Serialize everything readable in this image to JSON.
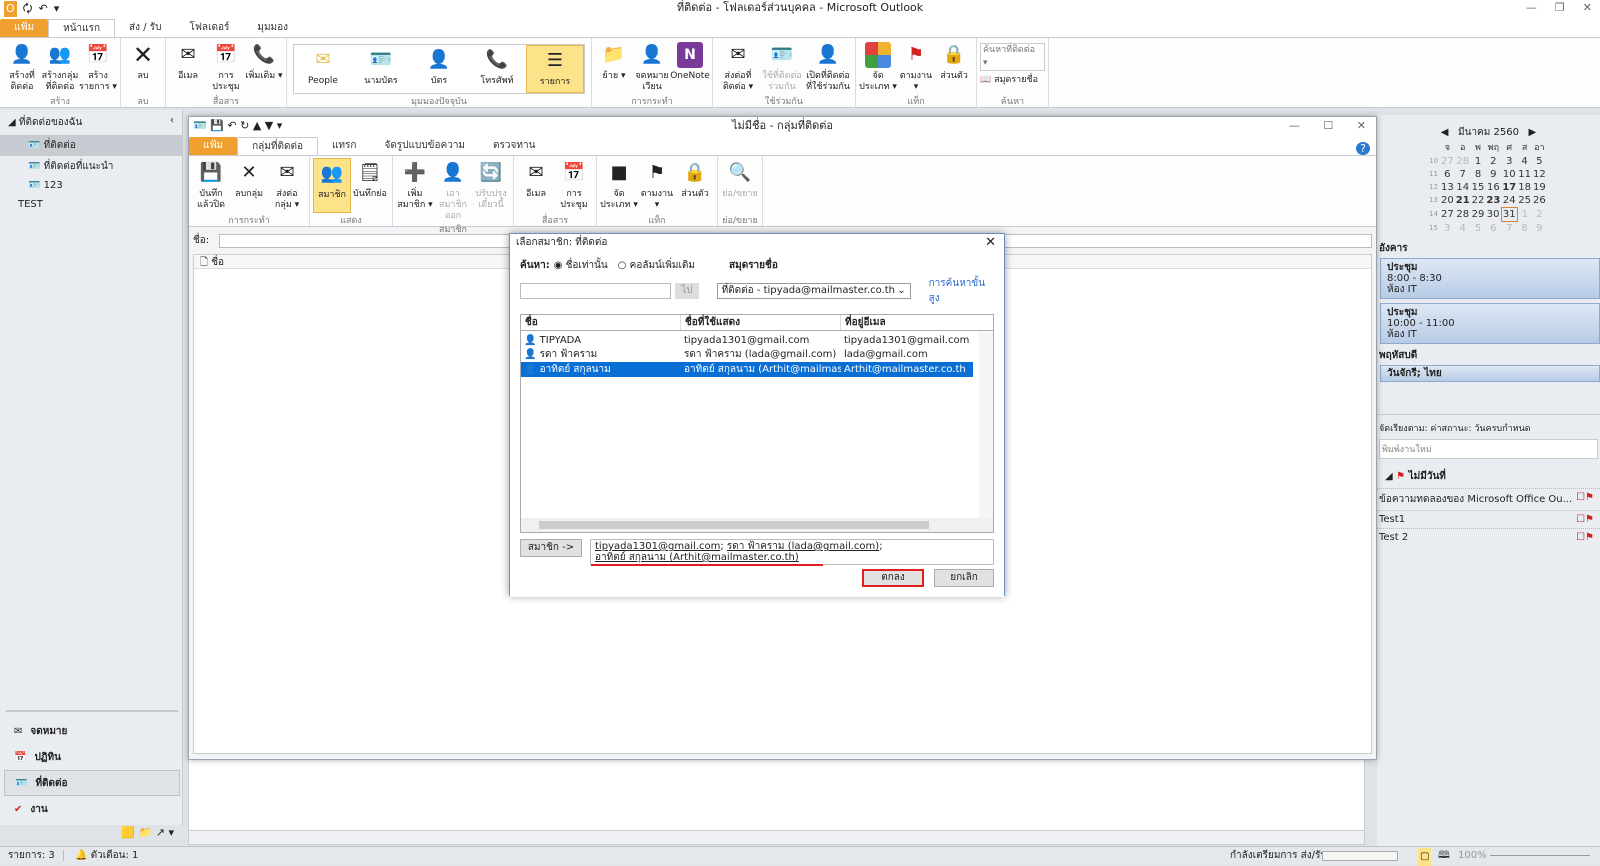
{
  "window_title": "ที่ติดต่อ - โฟลเดอร์ส่วนบุคคล - Microsoft Outlook",
  "main_tabs": [
    "แฟ้ม",
    "หน้าแรก",
    "ส่ง / รับ",
    "โฟลเดอร์",
    "มุมมอง"
  ],
  "main_ribbon": {
    "groups": [
      {
        "label": "สร้าง",
        "buttons": [
          "สร้างที่ติดต่อ",
          "สร้างกลุ่มที่ติดต่อ",
          "สร้างรายการ ▾"
        ]
      },
      {
        "label": "ลบ",
        "buttons": [
          "ลบ"
        ]
      },
      {
        "label": "สื่อสาร",
        "buttons": [
          "อีเมล",
          "การประชุม",
          "เพิ่มเติม ▾"
        ]
      },
      {
        "label": "มุมมองปัจจุบัน",
        "buttons": [
          "People",
          "นามบัตร",
          "บัตร",
          "โทรศัพท์",
          "รายการ"
        ]
      },
      {
        "label": "การกระทำ",
        "buttons": [
          "ย้าย ▾",
          "จดหมายเวียน",
          "OneNote"
        ]
      },
      {
        "label": "ใช้ร่วมกัน",
        "buttons": [
          "ส่งต่อที่ติดต่อ ▾",
          "ใช้ที่ติดต่อร่วมกัน",
          "เปิดที่ติดต่อที่ใช้ร่วมกัน"
        ]
      },
      {
        "label": "แท็ก",
        "buttons": [
          "จัดประเภท ▾",
          "ตามงาน ▾",
          "ส่วนตัว"
        ]
      }
    ],
    "search": {
      "label": "ค้นหา",
      "find_contact": "ค้นหาที่ติดต่อ ▾",
      "address_book": "สมุดรายชื่อ"
    },
    "selected_view": "รายการ"
  },
  "nav": {
    "header": "ที่ติดต่อของฉัน",
    "folders": [
      "ที่ติดต่อ",
      "ที่ติดต่อที่แนะนำ",
      "123"
    ],
    "extra": "TEST",
    "modules": [
      "จดหมาย",
      "ปฏิทิน",
      "ที่ติดต่อ",
      "งาน"
    ],
    "selected_module": "ที่ติดต่อ"
  },
  "status": {
    "items": "รายการ: 3",
    "reminders": "ตัวเตือน: 1",
    "sending": "กำลังเตรียมการ ส่ง/รับ...",
    "zoom": "100%"
  },
  "group_window": {
    "title": "ไม่มีชื่อ - กลุ่มที่ติดต่อ",
    "tabs": [
      "แฟ้ม",
      "กลุ่มที่ติดต่อ",
      "แทรก",
      "จัดรูปแบบข้อความ",
      "ตรวจทาน"
    ],
    "groups": [
      {
        "label": "การกระทำ",
        "buttons": [
          "บันทึกแล้วปิด",
          "ลบกลุ่ม",
          "ส่งต่อกลุ่ม ▾"
        ]
      },
      {
        "label": "แสดง",
        "buttons": [
          "สมาชิก",
          "บันทึกย่อ"
        ]
      },
      {
        "label": "สมาชิก",
        "buttons": [
          "เพิ่มสมาชิก ▾",
          "เอาสมาชิกออก",
          "ปรับปรุงเดี๋ยวนี้"
        ]
      },
      {
        "label": "สื่อสาร",
        "buttons": [
          "อีเมล",
          "การประชุม"
        ]
      },
      {
        "label": "แท็ก",
        "buttons": [
          "จัดประเภท ▾",
          "ตามงาน ▾",
          "ส่วนตัว"
        ]
      },
      {
        "label": "ย่อ/ขยาย",
        "buttons": [
          "ย่อ/ขยาย"
        ]
      }
    ],
    "name_label": "ชื่อ:",
    "column": "ชื่อ"
  },
  "dialog": {
    "title": "เลือกสมาชิก: ที่ติดต่อ",
    "search_label": "ค้นหา:",
    "radio_name_only": "ชื่อเท่านั้น",
    "radio_more": "คอลัมน์เพิ่มเติม",
    "search_value": "",
    "go": "ไป",
    "address_book_label": "สมุดรายชื่อ",
    "address_book_value": "ที่ติดต่อ - tipyada@mailmaster.co.th",
    "advanced": "การค้นหาขั้นสูง",
    "columns": [
      "ชื่อ",
      "ชื่อที่ใช้แสดง",
      "ที่อยู่อีเมล"
    ],
    "rows": [
      {
        "name": "TIPYADA",
        "display": "tipyada1301@gmail.com",
        "email": "tipyada1301@gmail.com",
        "selected": false
      },
      {
        "name": "รดา ฟ้าคราม",
        "display": "รดา ฟ้าคราม (lada@gmail.com)",
        "email": "lada@gmail.com",
        "selected": false
      },
      {
        "name": "อาทิตย์ สกุลนาม",
        "display": "อาทิตย์ สกุลนาม (Arthit@mailmaster....",
        "email": "Arthit@mailmaster.co.th",
        "selected": true
      }
    ],
    "members_button": "สมาชิก ->",
    "members_line1a": "tipyada1301@gmail.com",
    "members_line1b": "รดา ฟ้าคราม (lada@gmail.com)",
    "members_line2": "อาทิตย์ สกุลนาม (Arthit@mailmaster.co.th)",
    "ok": "ตกลง",
    "cancel": "ยกเลิก"
  },
  "todo": {
    "month": "มีนาคม 2560",
    "weekdays": [
      "จ",
      "อ",
      "พ",
      "พฤ",
      "ศ",
      "ส",
      "อา"
    ],
    "weeks": [
      {
        "wk": "10",
        "days": [
          "27",
          "28",
          "1",
          "2",
          "3",
          "4",
          "5"
        ]
      },
      {
        "wk": "11",
        "days": [
          "6",
          "7",
          "8",
          "9",
          "10",
          "11",
          "12"
        ]
      },
      {
        "wk": "12",
        "days": [
          "13",
          "14",
          "15",
          "16",
          "17",
          "18",
          "19"
        ]
      },
      {
        "wk": "13",
        "days": [
          "20",
          "21",
          "22",
          "23",
          "24",
          "25",
          "26"
        ]
      },
      {
        "wk": "14",
        "days": [
          "27",
          "28",
          "29",
          "30",
          "31",
          "1",
          "2"
        ]
      },
      {
        "wk": "15",
        "days": [
          "3",
          "4",
          "5",
          "6",
          "7",
          "8",
          "9"
        ]
      }
    ],
    "today": "31",
    "day1": "อังคาร",
    "appointments": [
      {
        "title": "ประชุม",
        "time": "8:00 - 8:30",
        "place": "ห้อง IT"
      },
      {
        "title": "ประชุม",
        "time": "10:00 - 11:00",
        "place": "ห้อง IT"
      }
    ],
    "day2": "พฤหัสบดี",
    "allday": "วันจักรี; ไทย",
    "task_sort": "จัดเรียงตาม: ค่าสถานะ: วันครบกำหนด",
    "task_placeholder": "พิมพ์งานใหม่",
    "task_group": "ไม่มีวันที่",
    "tasks": [
      "ข้อความทดลองของ Microsoft Office Ou...",
      "Test1",
      "Test 2"
    ]
  },
  "colors": {
    "file_tab": "#f0a030",
    "selection": "#0a6fd4",
    "highlight_button": "#fce38a",
    "annotation_red": "#e02020"
  }
}
